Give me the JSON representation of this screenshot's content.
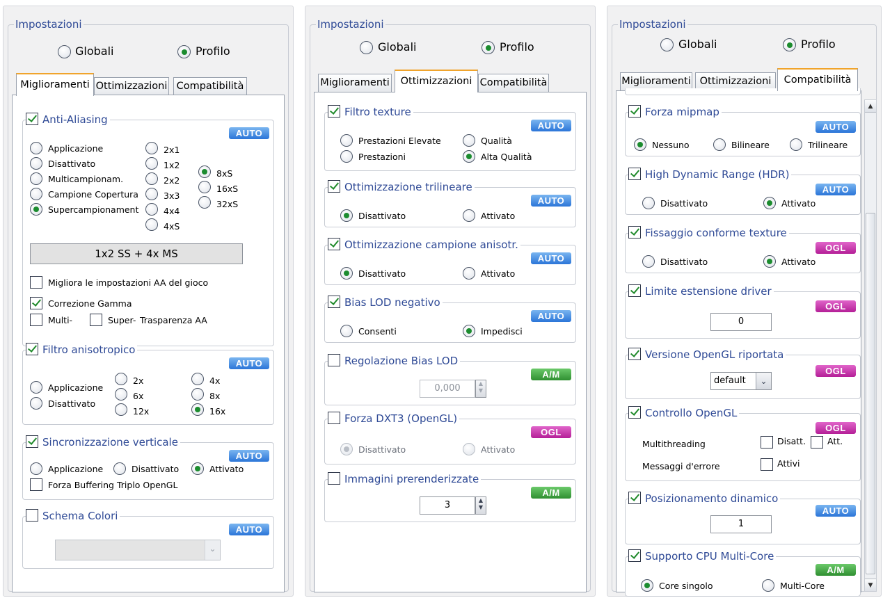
{
  "panels": [
    {
      "group_title": "Impostazioni",
      "radio_global": "Globali",
      "radio_profile": "Profilo",
      "tabs": [
        "Miglioramenti",
        "Ottimizzazioni",
        "Compatibilità"
      ],
      "aa": {
        "title": "Anti-Aliasing",
        "badge": "AUTO",
        "modes": [
          "Applicazione",
          "Disattivato",
          "Multicampionam.",
          "Campione Copertura",
          "Supercampionament"
        ],
        "levels1": [
          "2x1",
          "1x2",
          "2x2",
          "3x3",
          "4x4",
          "4xS"
        ],
        "levels2": [
          "8xS",
          "16xS",
          "32xS"
        ],
        "display": "1x2 SS + 4x MS",
        "improve": "Migliora le impostazioni AA del gioco",
        "gamma": "Correzione Gamma",
        "multi": "Multi-",
        "super": "Super-",
        "transp": "Trasparenza AA"
      },
      "aniso": {
        "title": "Filtro anisotropico",
        "badge": "AUTO",
        "modes": [
          "Applicazione",
          "Disattivato"
        ],
        "levels": [
          "2x",
          "6x",
          "12x",
          "4x",
          "8x",
          "16x"
        ]
      },
      "vsync": {
        "title": "Sincronizzazione verticale",
        "badge": "AUTO",
        "opts": [
          "Applicazione",
          "Disattivato",
          "Attivato"
        ],
        "triple": "Forza Buffering Triplo OpenGL"
      },
      "color": {
        "title": "Schema Colori",
        "badge": "AUTO"
      }
    },
    {
      "group_title": "Impostazioni",
      "radio_global": "Globali",
      "radio_profile": "Profilo",
      "tabs": [
        "Miglioramenti",
        "Ottimizzazioni",
        "Compatibilità"
      ],
      "tex": {
        "title": "Filtro texture",
        "badge": "AUTO",
        "opts": [
          "Prestazioni Elevate",
          "Qualità",
          "Prestazioni",
          "Alta Qualità"
        ]
      },
      "tri": {
        "title": "Ottimizzazione trilineare",
        "badge": "AUTO",
        "opts": [
          "Disattivato",
          "Attivato"
        ]
      },
      "anis": {
        "title": "Ottimizzazione campione anisotr.",
        "badge": "AUTO",
        "opts": [
          "Disattivato",
          "Attivato"
        ]
      },
      "lod": {
        "title": "Bias LOD negativo",
        "badge": "AUTO",
        "opts": [
          "Consenti",
          "Impedisci"
        ]
      },
      "lodadj": {
        "title": "Regolazione Bias LOD",
        "badge": "A/M",
        "value": "0,000"
      },
      "dxt": {
        "title": "Forza DXT3 (OpenGL)",
        "badge": "OGL",
        "opts": [
          "Disattivato",
          "Attivato"
        ]
      },
      "pre": {
        "title": "Immagini prerenderizzate",
        "badge": "A/M",
        "value": "3"
      }
    },
    {
      "group_title": "Impostazioni",
      "radio_global": "Globali",
      "radio_profile": "Profilo",
      "tabs": [
        "Miglioramenti",
        "Ottimizzazioni",
        "Compatibilità"
      ],
      "mip": {
        "title": "Forza mipmap",
        "badge": "AUTO",
        "opts": [
          "Nessuno",
          "Bilineare",
          "Trilineare"
        ]
      },
      "hdr": {
        "title": "High Dynamic Range (HDR)",
        "badge": "AUTO",
        "opts": [
          "Disattivato",
          "Attivato"
        ]
      },
      "fix": {
        "title": "Fissaggio conforme texture",
        "badge": "OGL",
        "opts": [
          "Disattivato",
          "Attivato"
        ]
      },
      "ext": {
        "title": "Limite estensione driver",
        "badge": "OGL",
        "value": "0"
      },
      "ver": {
        "title": "Versione OpenGL riportata",
        "badge": "OGL",
        "value": "default"
      },
      "ctl": {
        "title": "Controllo OpenGL",
        "badge": "OGL",
        "mt": "Multithreading",
        "dis": "Disatt.",
        "att": "Att.",
        "err": "Messaggi d'errore",
        "act": "Attivi"
      },
      "pos": {
        "title": "Posizionamento dinamico",
        "badge": "AUTO",
        "value": "1"
      },
      "cpu": {
        "title": "Supporto CPU Multi-Core",
        "badge": "A/M",
        "opts": [
          "Core singolo",
          "Multi-Core"
        ]
      }
    }
  ]
}
